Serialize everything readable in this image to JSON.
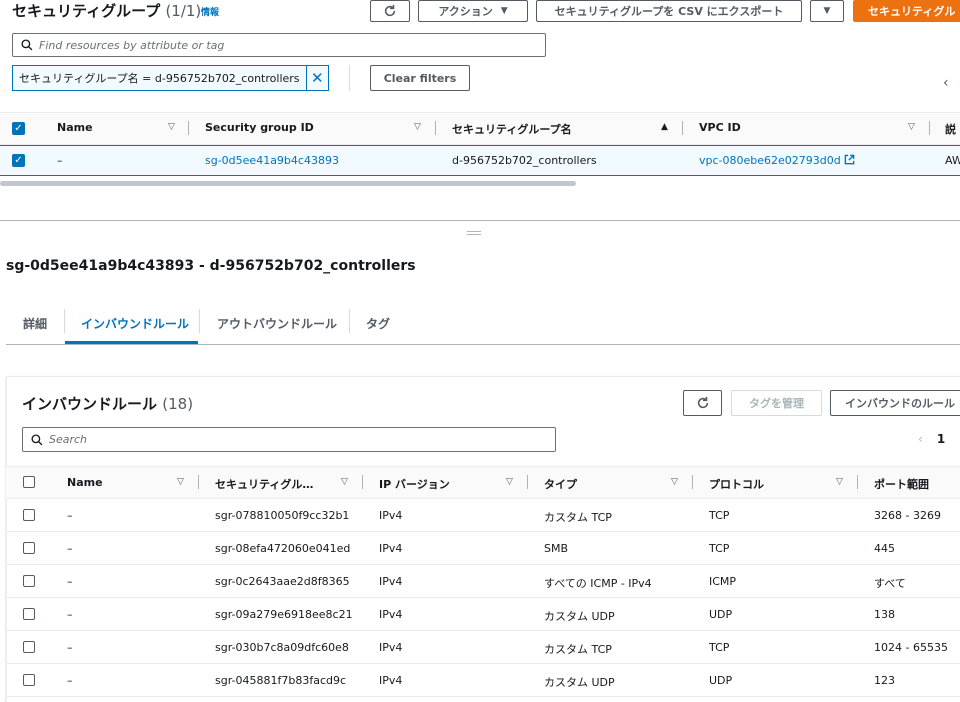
{
  "top": {
    "title": "セキュリティグループ",
    "count": "(1/1)",
    "info": "情報",
    "refresh_icon": "refresh-icon",
    "actions_label": "アクション",
    "export_label": "セキュリティグループを CSV にエクスポート",
    "create_label": "セキュリティグル",
    "search_placeholder": "Find resources by attribute or tag",
    "filter_chip": "セキュリティグループ名 = d-956752b702_controllers",
    "clear_filters": "Clear filters",
    "columns": [
      "Name",
      "Security group ID",
      "セキュリティグループ名",
      "VPC ID",
      "説"
    ],
    "row": {
      "name": "–",
      "sg_id": "sg-0d5ee41a9b4c43893",
      "sg_name": "d-956752b702_controllers",
      "vpc_id": "vpc-080ebe62e02793d0d",
      "desc": "AW"
    }
  },
  "details": {
    "title": "sg-0d5ee41a9b4c43893 - d-956752b702_controllers",
    "tabs": [
      "詳細",
      "インバウンドルール",
      "アウトバウンドルール",
      "タグ"
    ],
    "active_tab": "インバウンドルール"
  },
  "inbound": {
    "title": "インバウンドルール",
    "count": "(18)",
    "manage_tags": "タグを管理",
    "edit_label": "インバウンドのルール",
    "search_placeholder": "Search",
    "page": "1",
    "columns": [
      "Name",
      "セキュリティグル…",
      "IP バージョン",
      "タイプ",
      "プロトコル",
      "ポート範囲"
    ],
    "rows": [
      {
        "name": "–",
        "rule_id": "sgr-078810050f9cc32b1",
        "ip": "IPv4",
        "type": "カスタム TCP",
        "protocol": "TCP",
        "port": "3268 - 3269"
      },
      {
        "name": "–",
        "rule_id": "sgr-08efa472060e041ed",
        "ip": "IPv4",
        "type": "SMB",
        "protocol": "TCP",
        "port": "445"
      },
      {
        "name": "–",
        "rule_id": "sgr-0c2643aae2d8f8365",
        "ip": "IPv4",
        "type": "すべての ICMP - IPv4",
        "protocol": "ICMP",
        "port": "すべて"
      },
      {
        "name": "–",
        "rule_id": "sgr-09a279e6918ee8c21",
        "ip": "IPv4",
        "type": "カスタム UDP",
        "protocol": "UDP",
        "port": "138"
      },
      {
        "name": "–",
        "rule_id": "sgr-030b7c8a09dfc60e8",
        "ip": "IPv4",
        "type": "カスタム TCP",
        "protocol": "TCP",
        "port": "1024 - 65535"
      },
      {
        "name": "–",
        "rule_id": "sgr-045881f7b83facd9c",
        "ip": "IPv4",
        "type": "カスタム UDP",
        "protocol": "UDP",
        "port": "123"
      }
    ]
  }
}
